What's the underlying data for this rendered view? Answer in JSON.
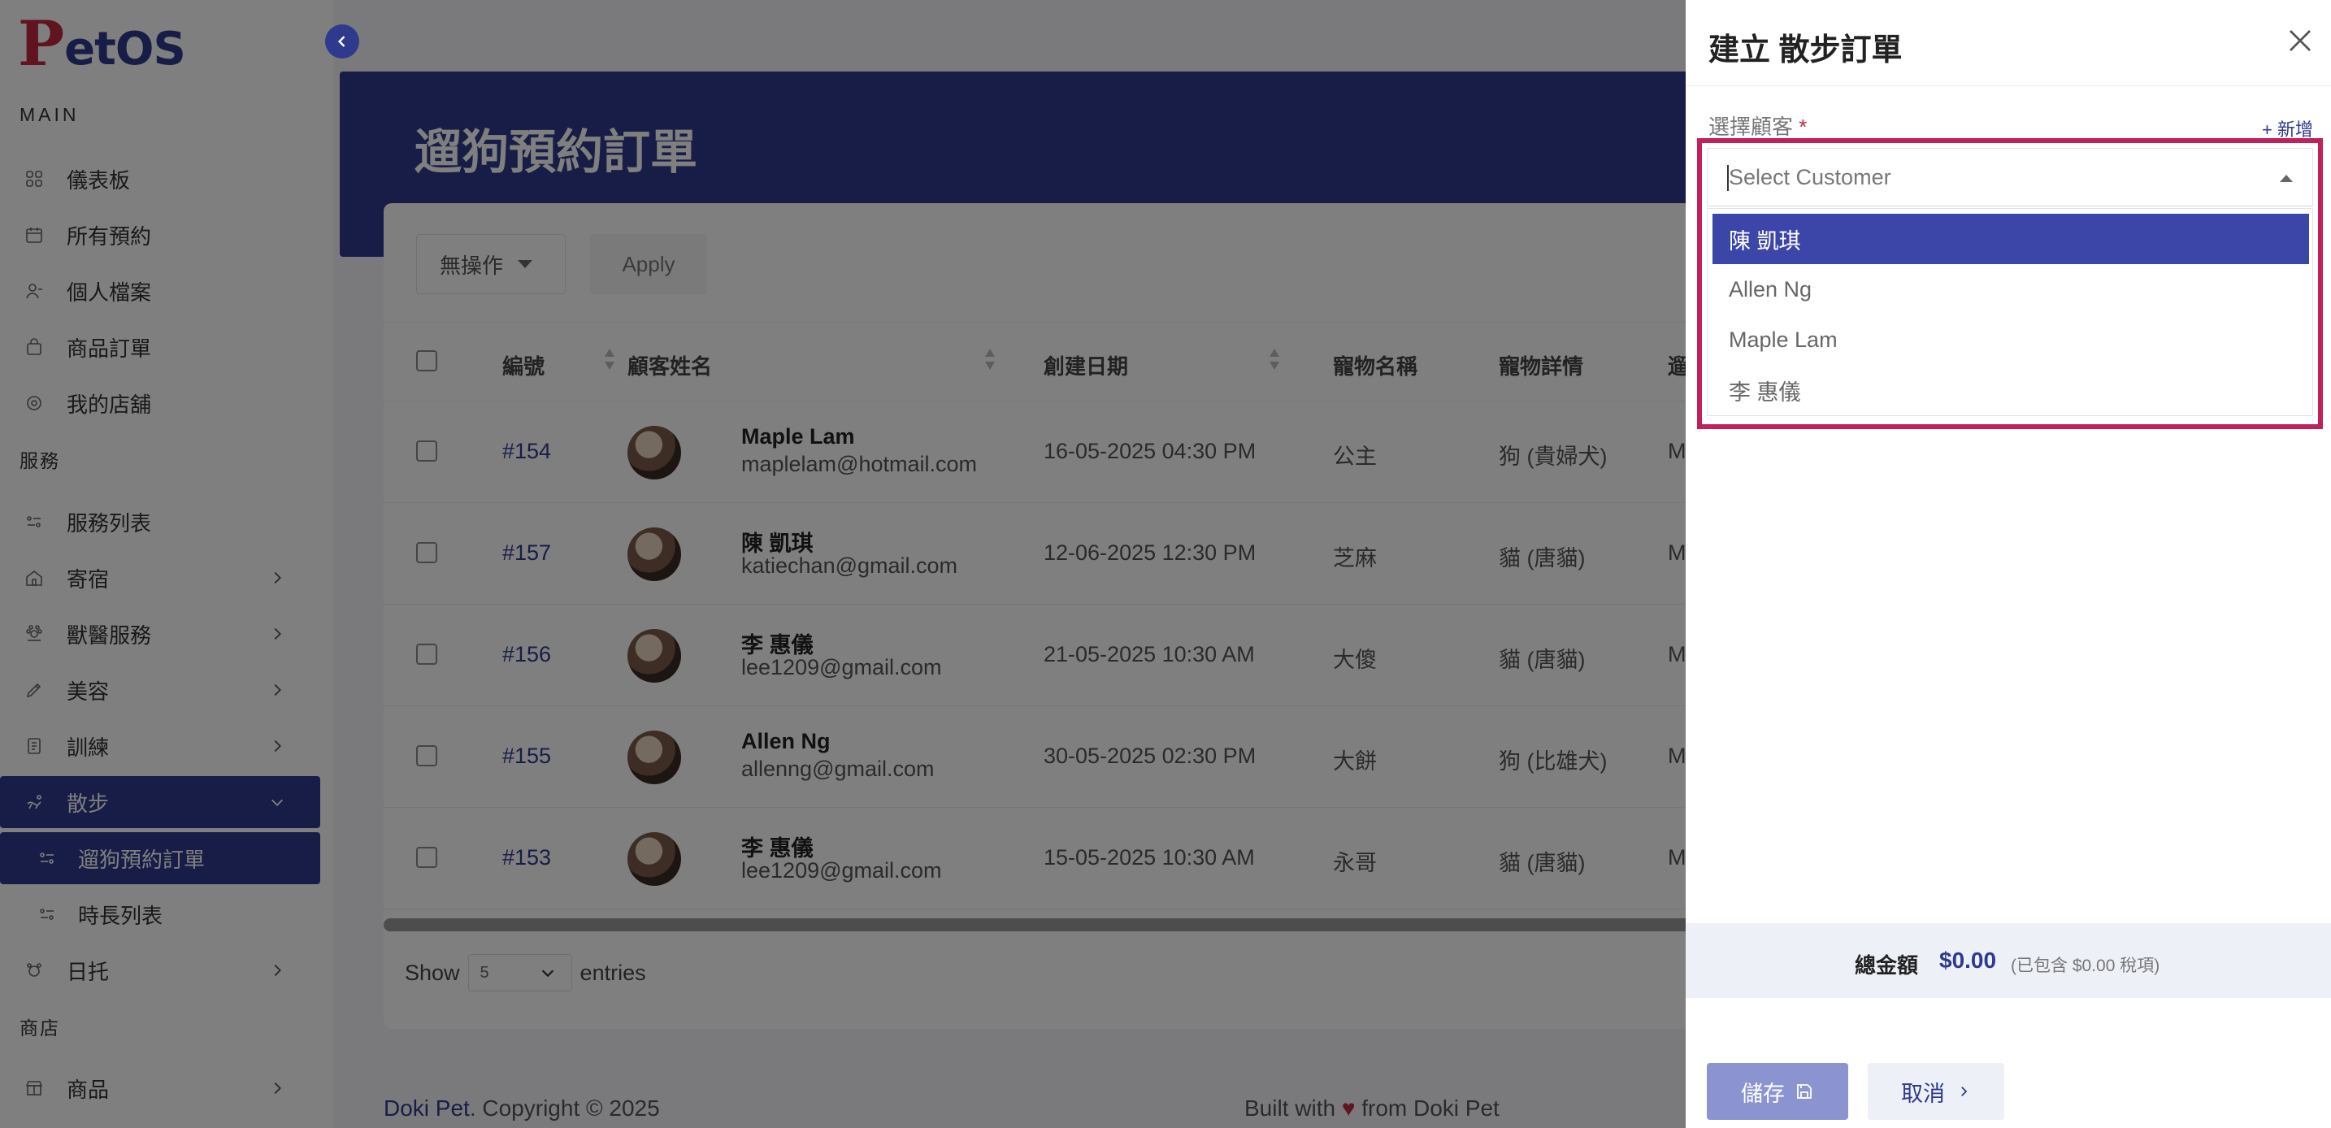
{
  "sidebar": {
    "logo_first": "P",
    "logo_rest": "etOS",
    "sections": {
      "main": "MAIN",
      "services": "服務",
      "shop": "商店"
    },
    "items": [
      {
        "label": "儀表板",
        "icon": "dashboard-icon"
      },
      {
        "label": "所有預約",
        "icon": "calendar-icon"
      },
      {
        "label": "個人檔案",
        "icon": "user-icon"
      },
      {
        "label": "商品訂單",
        "icon": "bag-icon"
      },
      {
        "label": "我的店舖",
        "icon": "store-icon"
      },
      {
        "label": "服務列表",
        "icon": "list-icon"
      },
      {
        "label": "寄宿",
        "icon": "home-icon"
      },
      {
        "label": "獸醫服務",
        "icon": "vet-icon"
      },
      {
        "label": "美容",
        "icon": "brush-icon"
      },
      {
        "label": "訓練",
        "icon": "training-icon"
      },
      {
        "label": "散步",
        "icon": "walk-icon"
      },
      {
        "label": "遛狗預約訂單",
        "icon": "list-icon"
      },
      {
        "label": "時長列表",
        "icon": "list-icon"
      },
      {
        "label": "日托",
        "icon": "daycare-icon"
      },
      {
        "label": "商品",
        "icon": "shop-icon"
      }
    ]
  },
  "main": {
    "page_title": "遛狗預約訂單",
    "bulk_action": "無操作",
    "apply_label": "Apply",
    "columns": [
      "編號",
      "顧客姓名",
      "創建日期",
      "寵物名稱",
      "寵物詳情",
      "遛狗員"
    ],
    "rows": [
      {
        "id": "#154",
        "name": "Maple Lam",
        "email": "maplelam@hotmail.com",
        "date": "16-05-2025 04:30 PM",
        "pet": "公主",
        "detail": "狗 (貴婦犬)",
        "walker": "Meow"
      },
      {
        "id": "#157",
        "name": "陳 凱琪",
        "email": "katiechan@gmail.com",
        "date": "12-06-2025 12:30 PM",
        "pet": "芝麻",
        "detail": "貓 (唐貓)",
        "walker": "Meow"
      },
      {
        "id": "#156",
        "name": "李 惠儀",
        "email": "lee1209@gmail.com",
        "date": "21-05-2025 10:30 AM",
        "pet": "大傻",
        "detail": "貓 (唐貓)",
        "walker": "Meow"
      },
      {
        "id": "#155",
        "name": "Allen Ng",
        "email": "allenng@gmail.com",
        "date": "30-05-2025 02:30 PM",
        "pet": "大餅",
        "detail": "狗 (比雄犬)",
        "walker": "Meow"
      },
      {
        "id": "#153",
        "name": "李 惠儀",
        "email": "lee1209@gmail.com",
        "date": "15-05-2025 10:30 AM",
        "pet": "永哥",
        "detail": "貓 (唐貓)",
        "walker": "Meow"
      }
    ],
    "show_label": "Show",
    "entries_value": "5",
    "entries_label": "entries",
    "footer_brand": "Doki Pet",
    "footer_copyright": ". Copyright © 2025",
    "footer_built_prefix": "Built with",
    "footer_heart": "♥",
    "footer_built_suffix": "from Doki Pet"
  },
  "drawer": {
    "title": "建立 散步訂單",
    "customer_label": "選擇顧客",
    "required_mark": "*",
    "add_label": "+ 新增",
    "placeholder": "Select Customer",
    "options": [
      "陳 凱琪",
      "Allen Ng",
      "Maple Lam",
      "李 惠儀"
    ],
    "selected_index": 0,
    "total_label": "總金額",
    "total_amount": "$0.00",
    "total_tax": "(已包含 $0.00 稅項)",
    "save_label": "儲存",
    "cancel_label": "取消"
  },
  "colors": {
    "primary": "#2f3a8f",
    "highlight_border": "#c21f5b",
    "selected_option": "#3c46a8",
    "logo_red": "#c0283e"
  }
}
